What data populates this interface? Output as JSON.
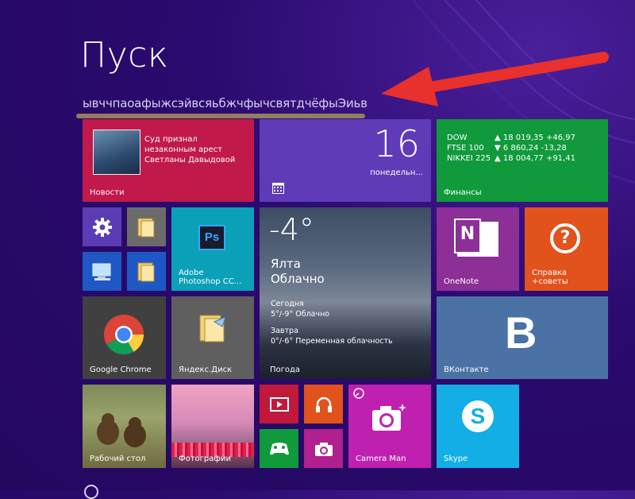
{
  "start": {
    "title": "Пуск",
    "user_text": "ывччпаоафыжсэйвсяьбжчфычсвятдчёфыЭиьв"
  },
  "tiles": {
    "news": {
      "label": "Новости",
      "headline_1": "Суд признал",
      "headline_2": "незаконным арест",
      "headline_3": "Светланы Давыдовой",
      "color": "#c0194a"
    },
    "calendar": {
      "day": "16",
      "weekday": "понедельн...",
      "color": "#5f3bb8"
    },
    "finance": {
      "label": "Финансы",
      "color": "#109a3c",
      "rows": [
        {
          "name": "DOW",
          "value": "▲ 18 019,35 +46,97"
        },
        {
          "name": "FTSE 100",
          "value": "▼ 6 860,24 -13,28"
        },
        {
          "name": "NIKKEI 225",
          "value": "▲ 18 004,77 +91,41"
        }
      ]
    },
    "settings": {
      "color": "#5c3cb5"
    },
    "explorer": {
      "color": "#6b6b6b"
    },
    "computer": {
      "color": "#1f58c4"
    },
    "folder_blue": {
      "color": "#1f58c4"
    },
    "photoshop": {
      "label_1": "Adobe",
      "label_2": "Photoshop CC...",
      "color": "#0aa0b8",
      "icon_text": "Ps"
    },
    "weather": {
      "temp": "-4°",
      "city": "Ялта",
      "condition": "Облачно",
      "today_label": "Сегодня",
      "today_value": "5°/-9° Облачно",
      "tomorrow_label": "Завтра",
      "tomorrow_value": "0°/-6° Переменная облачность",
      "label": "Погода"
    },
    "onenote": {
      "label": "OneNote",
      "color": "#8c2f97",
      "icon_text": "N"
    },
    "help": {
      "label_1": "Справка",
      "label_2": "+советы",
      "color": "#e2521c",
      "icon_text": "?"
    },
    "chrome": {
      "label": "Google Chrome",
      "color": "#404040"
    },
    "yadisk": {
      "label": "Яндекс.Диск",
      "color": "#5f5f5f"
    },
    "vk": {
      "label": "ВКонтакте",
      "color": "#4a72a5",
      "icon_text": "B"
    },
    "desktop": {
      "label": "Рабочий стол"
    },
    "photos": {
      "label": "Фотографии"
    },
    "video": {
      "color": "#c0193c"
    },
    "music": {
      "color": "#e2521c"
    },
    "games": {
      "color": "#109a3c"
    },
    "camera_small": {
      "color": "#b0208e"
    },
    "cameraman": {
      "label": "Camera Man",
      "color": "#c020b0"
    },
    "skype": {
      "label": "Skype",
      "color": "#13aee6",
      "icon_text": "S"
    }
  }
}
